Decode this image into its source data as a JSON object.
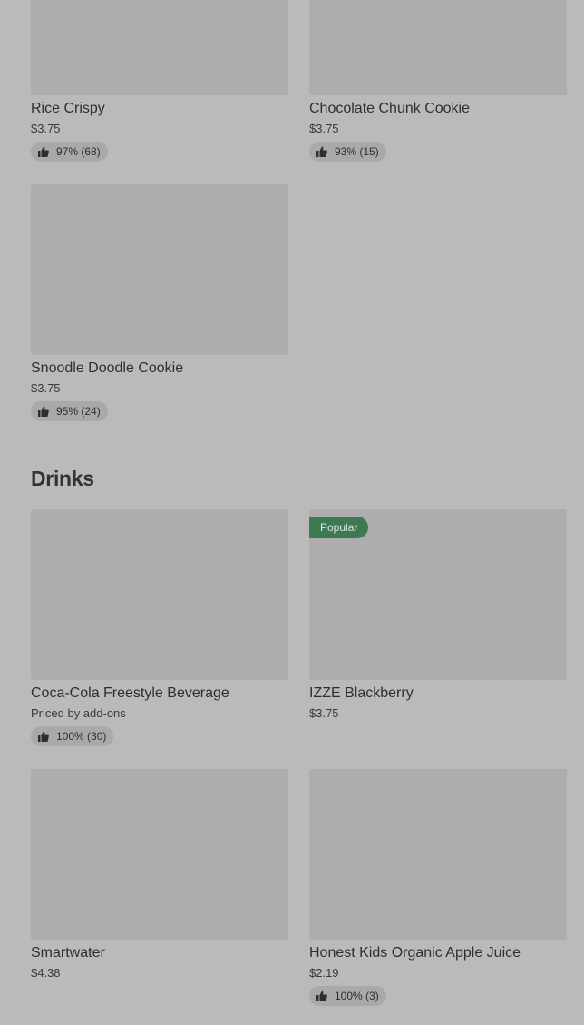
{
  "sections": {
    "desserts": {
      "items": [
        {
          "name": "Rice Crispy",
          "price": "$3.75",
          "rating": "97% (68)"
        },
        {
          "name": "Chocolate Chunk Cookie",
          "price": "$3.75",
          "rating": "93% (15)"
        },
        {
          "name": "Snoodle Doodle Cookie",
          "price": "$3.75",
          "rating": "95% (24)"
        }
      ]
    },
    "drinks": {
      "title": "Drinks",
      "items": [
        {
          "name": "Coca-Cola Freestyle Beverage",
          "price": "Priced by add-ons",
          "rating": "100% (30)"
        },
        {
          "name": "IZZE Blackberry",
          "price": "$3.75",
          "badge": "Popular"
        },
        {
          "name": "Smartwater",
          "price": "$4.38"
        },
        {
          "name": "Honest Kids Organic Apple Juice",
          "price": "$2.19",
          "rating": "100% (3)"
        }
      ]
    }
  },
  "icons": {
    "rating": "thumbs-up-icon"
  },
  "colors": {
    "background": "#bababa",
    "image_placeholder": "#adadad",
    "badge": "#3d7a52",
    "rating_pill": "#a9a9a9"
  }
}
